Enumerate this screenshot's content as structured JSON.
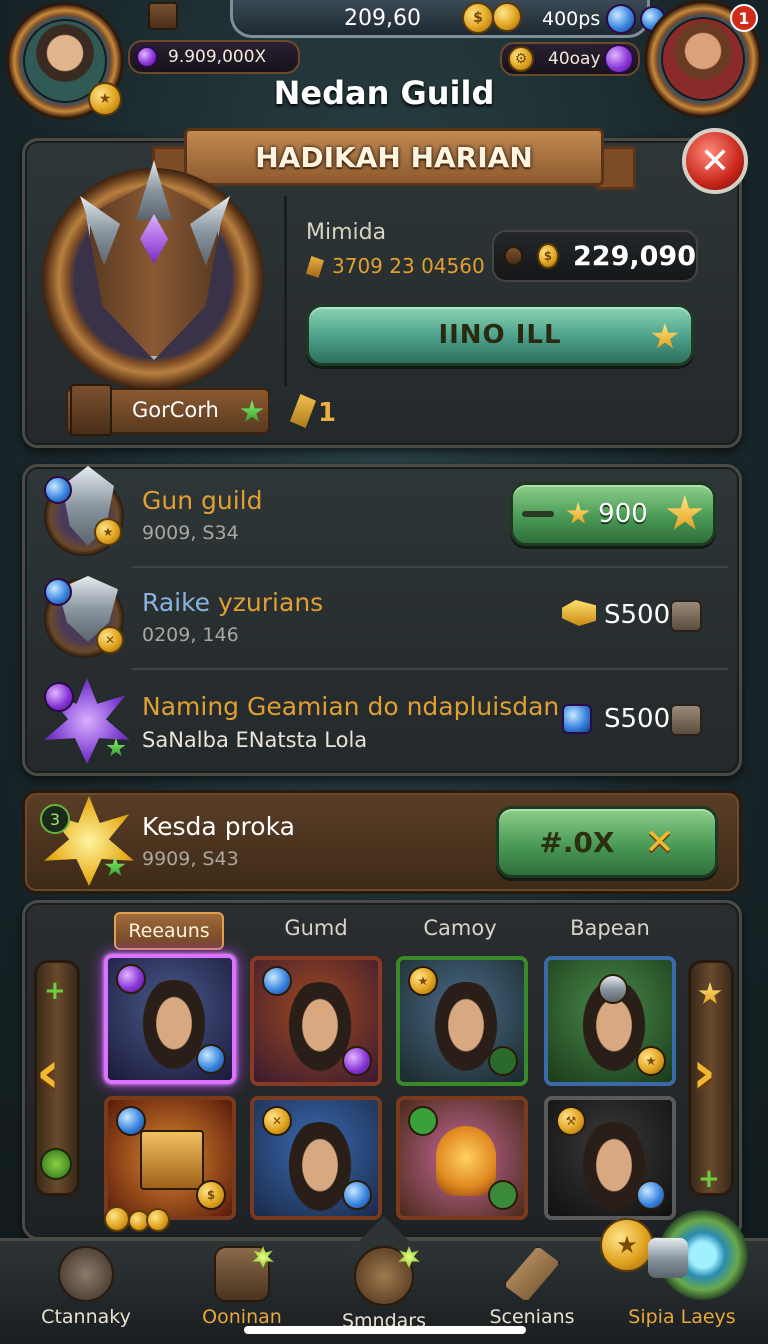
{
  "header": {
    "gold_amount": "209,60",
    "gem_amount": "9.909,000X",
    "rate_label": "400ps",
    "energy_label": "40oay",
    "title": "Nedan Guild",
    "notification_count": "1"
  },
  "daily_panel": {
    "banner_title": "HADIKAH HARIAN",
    "member_label": "Mimida",
    "member_id": "3709 23 04560",
    "currency_value": "229,090",
    "action_button_label": "IINO ILL",
    "guild_tag": "GorCorh",
    "level_value": "1"
  },
  "guild_list": [
    {
      "title": "Gun guild",
      "subtitle": "9009, S34",
      "reward": "900",
      "has_button": true,
      "title_color": "#e0a030"
    },
    {
      "title_part1": "Raike",
      "title_part2": "yzurians",
      "subtitle": "0209, 146",
      "reward": "S500",
      "title_color": "#8ab4e0"
    },
    {
      "title": "Naming Geamian do ndapluisdan",
      "subtitle": "SaNalba ENatsta Lola",
      "reward": "S500",
      "title_color": "#e0a030"
    }
  ],
  "special_offer": {
    "level_badge": "3",
    "title": "Kesda proka",
    "subtitle": "9909, S43",
    "button_label": "#.0X"
  },
  "hero_tabs": [
    "Reeauns",
    "Gumd",
    "Camoy",
    "Bapean"
  ],
  "bottom_nav": [
    {
      "label": "Ctannaky",
      "icon": "fortress-icon",
      "active": false
    },
    {
      "label": "Ooninan",
      "icon": "scroll-icon",
      "active": true
    },
    {
      "label": "Smndars",
      "icon": "sword-icon",
      "active": false
    },
    {
      "label": "Scenians",
      "icon": "hammer-icon",
      "active": false
    },
    {
      "label": "Sipia Laeys",
      "icon": "portal-icon",
      "active": false
    }
  ],
  "colors": {
    "accent_gold": "#e0a030",
    "button_green": "#4a9a56",
    "close_red": "#c8261a",
    "selected_glow": "#c040ff"
  }
}
